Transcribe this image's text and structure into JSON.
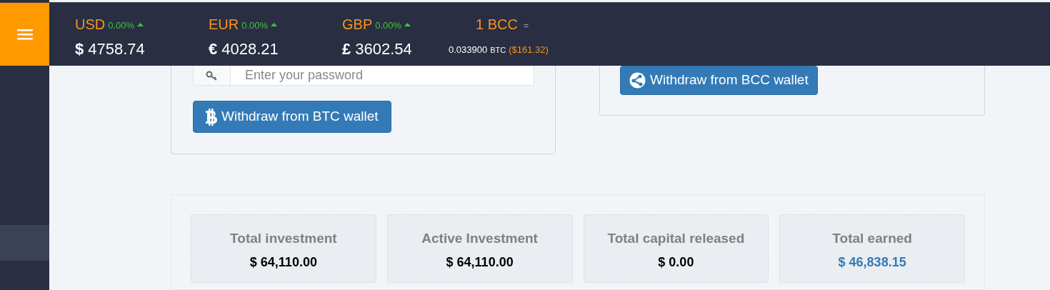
{
  "header": {
    "tickers": [
      {
        "kind": "fiat",
        "currency": "USD",
        "change": "0.00%",
        "rising": true,
        "symbol": "$",
        "value": "4758.74"
      },
      {
        "kind": "fiat",
        "currency": "EUR",
        "change": "0.00%",
        "rising": true,
        "symbol": "€",
        "value": "4028.21"
      },
      {
        "kind": "fiat",
        "currency": "GBP",
        "change": "0.00%",
        "rising": true,
        "symbol": "£",
        "value": "3602.54"
      },
      {
        "kind": "crypto",
        "currency": "1 BCC",
        "equals": "=",
        "amount": "0.033900",
        "unit": "BTC",
        "fiat": "($161.32)"
      }
    ]
  },
  "sidebar": {
    "items": [
      {
        "selected": true
      }
    ]
  },
  "btc_wallet": {
    "password": {
      "placeholder": "Enter your password"
    },
    "button": "Withdraw from BTC wallet"
  },
  "bcc_wallet": {
    "button": "Withdraw from BCC wallet"
  },
  "stats": [
    {
      "label": "Total investment",
      "value": "$ 64,110.00",
      "highlight": false
    },
    {
      "label": "Active Investment",
      "value": "$ 64,110.00",
      "highlight": false
    },
    {
      "label": "Total capital released",
      "value": "$ 0.00",
      "highlight": false
    },
    {
      "label": "Total earned",
      "value": "$ 46,838.15",
      "highlight": true
    }
  ]
}
